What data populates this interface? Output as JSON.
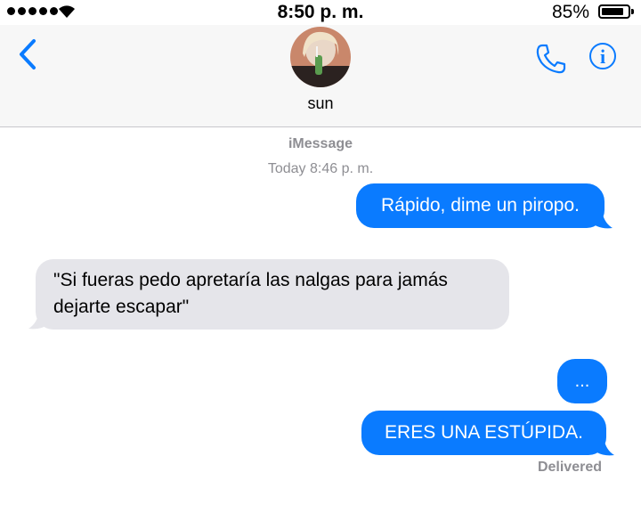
{
  "status_bar": {
    "time": "8:50 p. m.",
    "battery": "85%",
    "battery_level": 0.85,
    "signal_bars": 5,
    "icons": [
      "signal-dots-icon",
      "wifi-icon",
      "battery-icon"
    ]
  },
  "header": {
    "contact_name": "sun",
    "icons": [
      "back-chevron-icon",
      "phone-icon",
      "info-icon"
    ],
    "accent_color": "#0a7bff"
  },
  "conversation": {
    "service": "iMessage",
    "timestamp": "Today 8:46 p. m.",
    "messages": [
      {
        "direction": "outgoing",
        "text": "Rápido, dime un piropo."
      },
      {
        "direction": "incoming",
        "text": "\"Si fueras pedo apretaría las nalgas para jamás dejarte escapar\""
      },
      {
        "direction": "outgoing",
        "text": "..."
      },
      {
        "direction": "outgoing",
        "text": "ERES UNA ESTÚPIDA."
      }
    ],
    "delivered": "Delivered"
  },
  "colors": {
    "outgoing_bubble": "#0a7bff",
    "incoming_bubble": "#e5e5ea",
    "meta_text": "#8e8e93"
  }
}
